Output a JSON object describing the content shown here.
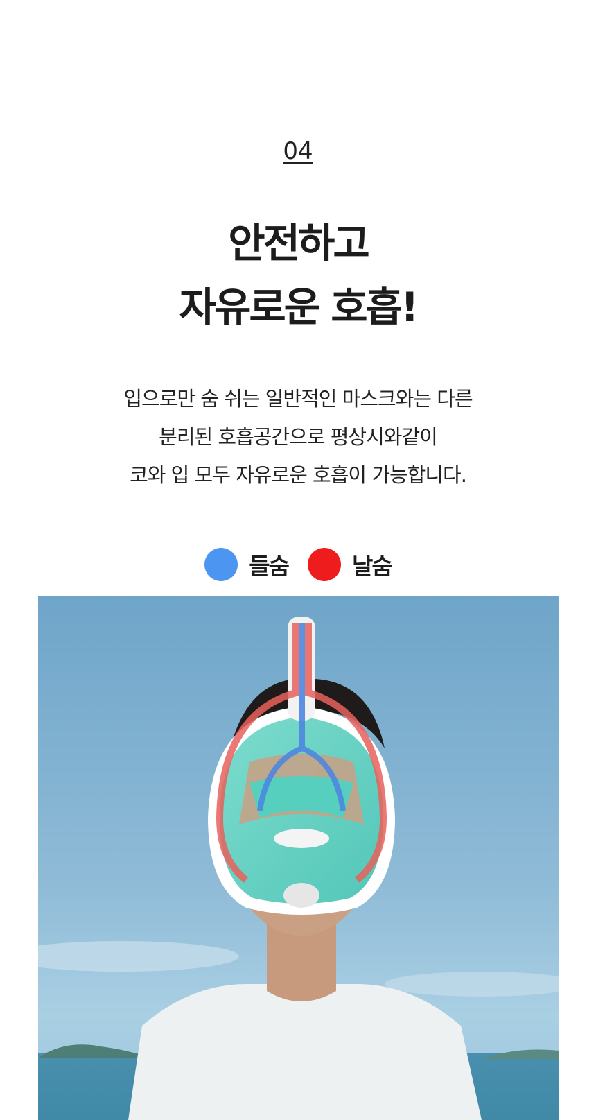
{
  "section": {
    "number": "04"
  },
  "headline": {
    "line1": "안전하고",
    "line2": "자유로운 호흡!"
  },
  "description": {
    "line1": "입으로만 숨 쉬는 일반적인 마스크와는 다른",
    "line2": "분리된 호흡공간으로 평상시와같이",
    "line3": "코와 입 모두 자유로운 호흡이 가능합니다."
  },
  "legend": {
    "inhale": {
      "label": "들숨",
      "color": "#4c96f2"
    },
    "exhale": {
      "label": "날숨",
      "color": "#ee1c1c"
    }
  }
}
